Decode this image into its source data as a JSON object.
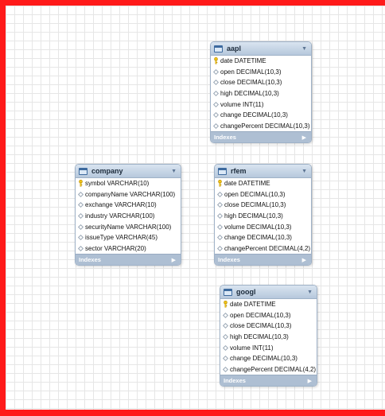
{
  "tables": [
    {
      "id": "aapl",
      "name": "aapl",
      "columns": [
        {
          "label": "date DATETIME",
          "primary_key": true
        },
        {
          "label": "open DECIMAL(10,3)",
          "primary_key": false
        },
        {
          "label": "close DECIMAL(10,3)",
          "primary_key": false
        },
        {
          "label": "high DECIMAL(10,3)",
          "primary_key": false
        },
        {
          "label": "volume INT(11)",
          "primary_key": false
        },
        {
          "label": "change DECIMAL(10,3)",
          "primary_key": false
        },
        {
          "label": "changePercent DECIMAL(10,3)",
          "primary_key": false
        }
      ],
      "footer": "Indexes"
    },
    {
      "id": "company",
      "name": "company",
      "columns": [
        {
          "label": "symbol VARCHAR(10)",
          "primary_key": true
        },
        {
          "label": "companyName VARCHAR(100)",
          "primary_key": false
        },
        {
          "label": "exchange VARCHAR(10)",
          "primary_key": false
        },
        {
          "label": "industry VARCHAR(100)",
          "primary_key": false
        },
        {
          "label": "securityName VARCHAR(100)",
          "primary_key": false
        },
        {
          "label": "issueType VARCHAR(45)",
          "primary_key": false
        },
        {
          "label": "sector VARCHAR(20)",
          "primary_key": false
        }
      ],
      "footer": "Indexes"
    },
    {
      "id": "rfem",
      "name": "rfem",
      "columns": [
        {
          "label": "date DATETIME",
          "primary_key": true
        },
        {
          "label": "open DECIMAL(10,3)",
          "primary_key": false
        },
        {
          "label": "close DECIMAL(10,3)",
          "primary_key": false
        },
        {
          "label": "high DECIMAL(10,3)",
          "primary_key": false
        },
        {
          "label": "volume DECIMAL(10,3)",
          "primary_key": false
        },
        {
          "label": "change DECIMAL(10,3)",
          "primary_key": false
        },
        {
          "label": "changePercent DECIMAL(4,2)",
          "primary_key": false
        }
      ],
      "footer": "Indexes"
    },
    {
      "id": "googl",
      "name": "googl",
      "columns": [
        {
          "label": "date DATETIME",
          "primary_key": true
        },
        {
          "label": "open DECIMAL(10,3)",
          "primary_key": false
        },
        {
          "label": "close DECIMAL(10,3)",
          "primary_key": false
        },
        {
          "label": "high DECIMAL(10,3)",
          "primary_key": false
        },
        {
          "label": "volume INT(11)",
          "primary_key": false
        },
        {
          "label": "change DECIMAL(10,3)",
          "primary_key": false
        },
        {
          "label": "changePercent DECIMAL(4,2)",
          "primary_key": false
        }
      ],
      "footer": "Indexes"
    }
  ],
  "icons": {
    "table": "table-icon",
    "primary_key": "key-icon",
    "column": "column-diamond-icon",
    "collapse": "chevron-down-icon",
    "expand": "chevron-right-icon"
  },
  "colors": {
    "frame_border": "#ff1a1a",
    "header_bg": "#b6c8dc",
    "footer_bg": "#aebfd3",
    "key_icon": "#f0c419"
  }
}
